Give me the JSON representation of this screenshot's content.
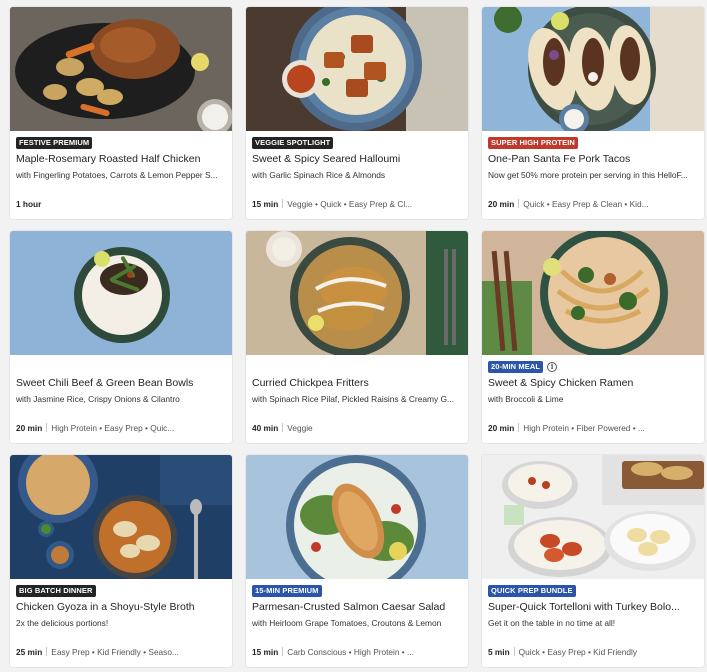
{
  "recipes": [
    {
      "badge": "FESTIVE PREMIUM",
      "badge_color": "#242424",
      "title": "Maple-Rosemary Roasted Half Chicken",
      "subtitle": "with Fingerling Potatoes, Carrots & Lemon Pepper S...",
      "time": "1 hour",
      "tags": ""
    },
    {
      "badge": "VEGGIE SPOTLIGHT",
      "badge_color": "#242424",
      "title": "Sweet & Spicy Seared Halloumi",
      "subtitle": "with Garlic Spinach Rice & Almonds",
      "time": "15 min",
      "tags": "Veggie • Quick • Easy Prep & Cl..."
    },
    {
      "badge": "SUPER HIGH PROTEIN",
      "badge_color": "#c0392b",
      "title": "One-Pan Santa Fe Pork Tacos",
      "subtitle": "Now get 50% more protein per serving in this HelloF...",
      "time": "20 min",
      "tags": "Quick • Easy Prep & Clean • Kid..."
    },
    {
      "badge": "",
      "badge_color": "",
      "title": "Sweet Chili Beef & Green Bean Bowls",
      "subtitle": "with Jasmine Rice, Crispy Onions & Cilantro",
      "time": "20 min",
      "tags": "High Protein • Easy Prep • Quic..."
    },
    {
      "badge": "",
      "badge_color": "",
      "title": "Curried Chickpea Fritters",
      "subtitle": "with Spinach Rice Pilaf, Pickled Raisins & Creamy G...",
      "time": "40 min",
      "tags": "Veggie"
    },
    {
      "badge": "20-MIN MEAL",
      "badge_color": "#2a55a8",
      "info": true,
      "title": "Sweet & Spicy Chicken Ramen",
      "subtitle": "with Broccoli & Lime",
      "time": "20 min",
      "tags": "High Protein • Fiber Powered • ..."
    },
    {
      "badge": "BIG BATCH DINNER",
      "badge_color": "#242424",
      "title": "Chicken Gyoza in a Shoyu-Style Broth",
      "subtitle": "2x the delicious portions!",
      "time": "25 min",
      "tags": "Easy Prep • Kid Friendly • Seaso..."
    },
    {
      "badge": "15-MIN PREMIUM",
      "badge_color": "#2a55a8",
      "title": "Parmesan-Crusted Salmon Caesar Salad",
      "subtitle": "with Heirloom Grape Tomatoes, Croutons & Lemon",
      "time": "15 min",
      "tags": "Carb Conscious • High Protein • ..."
    },
    {
      "badge": "QUICK PREP BUNDLE",
      "badge_color": "#2a55a8",
      "title": "Super-Quick Tortelloni with Turkey Bolo...",
      "subtitle": "Get it on the table in no time at all!",
      "time": "5 min",
      "tags": "Quick • Easy Prep • Kid Friendly"
    }
  ],
  "info_icon": "info-icon"
}
